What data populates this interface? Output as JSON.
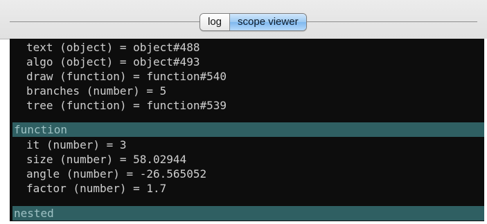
{
  "tabs": {
    "log": "log",
    "scope_viewer": "scope viewer"
  },
  "scopes": [
    {
      "lines": [
        "text (object) = object#488",
        "algo (object) = object#493",
        "draw (function) = function#540",
        "branches (number) = 5",
        "tree (function) = function#539"
      ]
    },
    {
      "header": "function",
      "lines": [
        "it (number) = 3",
        "size (number) = 58.02944",
        "angle (number) = -26.565052",
        "factor (number) = 1.7"
      ]
    },
    {
      "header": "nested",
      "lines": []
    }
  ],
  "colors": {
    "console_bg": "#0d0d0d",
    "scope_header_bg": "#2f5f62",
    "scope_header_text": "#9fc2c4",
    "variable_text": "#cfcfcf",
    "active_tab": "#9cc9f2"
  }
}
